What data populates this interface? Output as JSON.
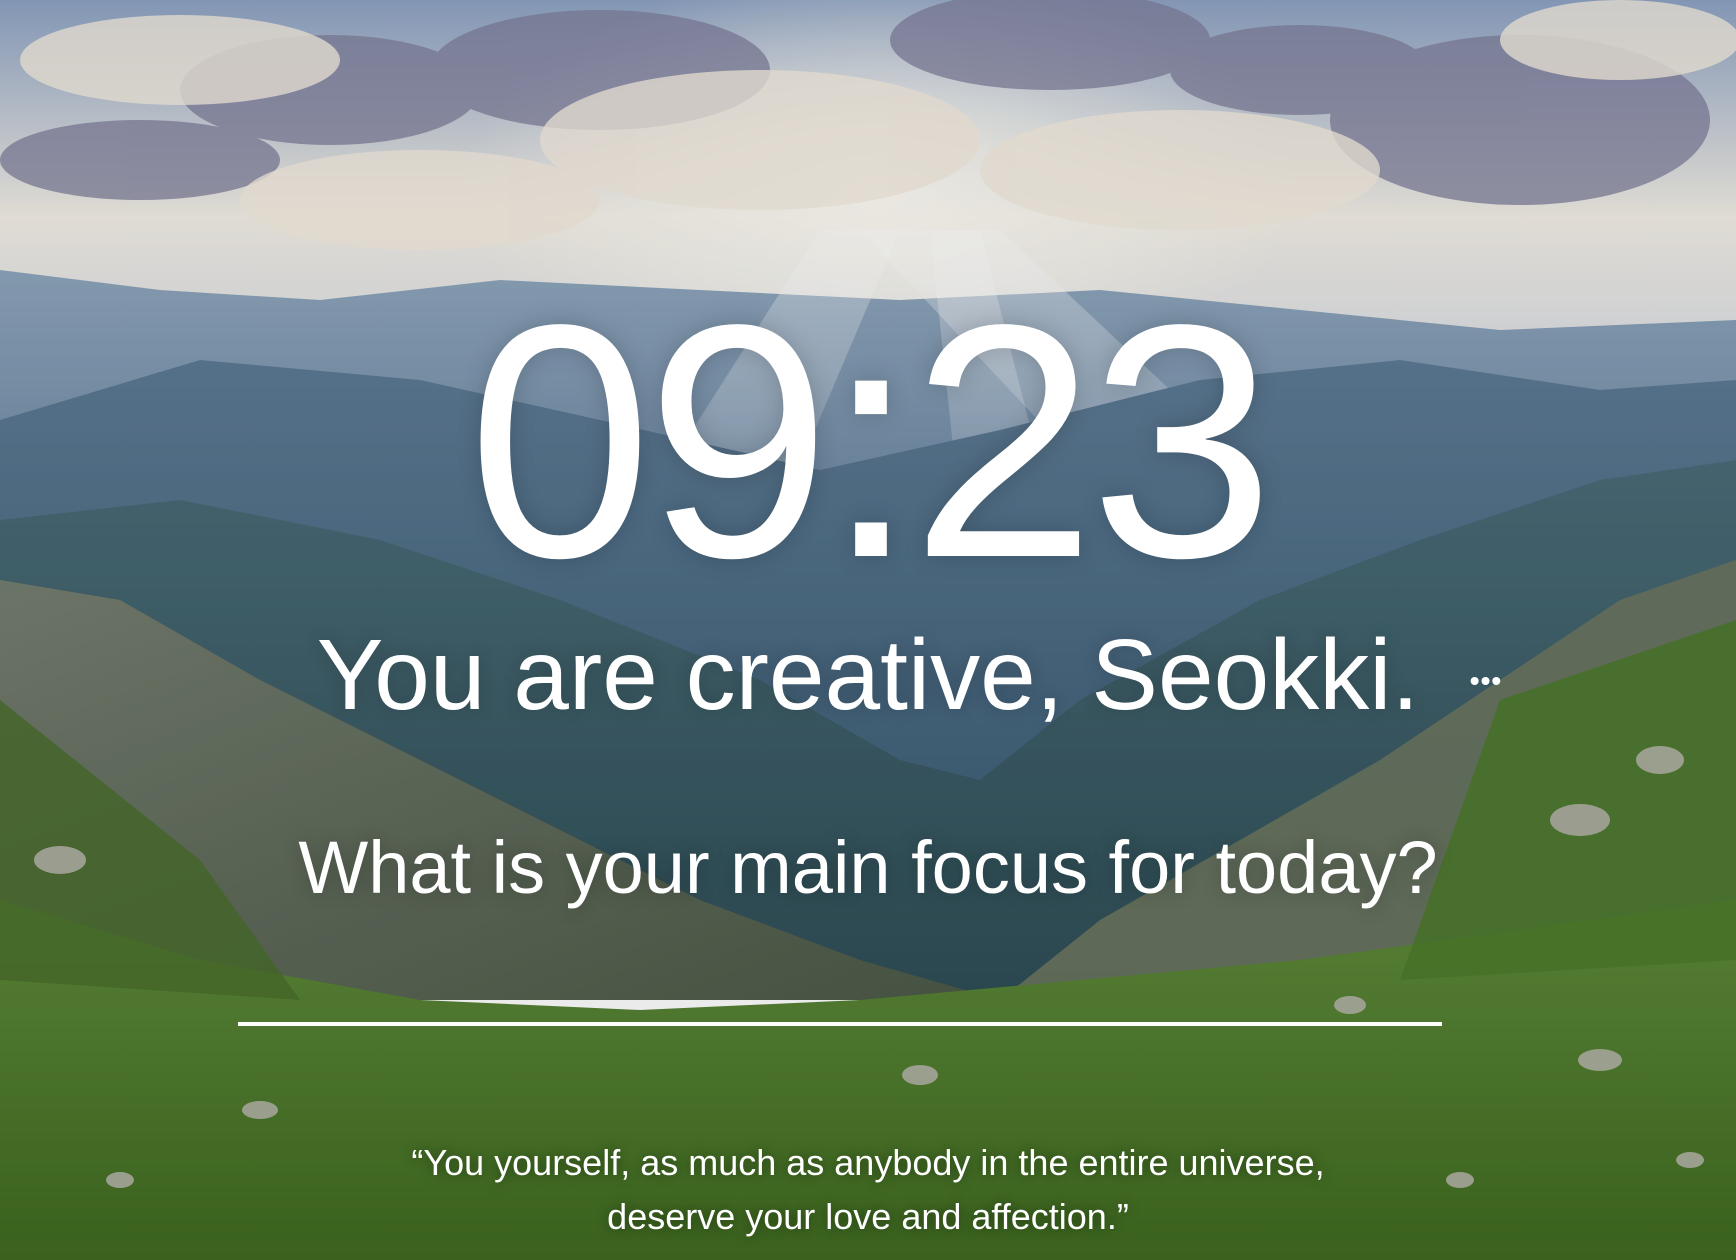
{
  "background": {
    "scene": "mountain-valley-sunrise-photo",
    "sky_color": "#cfd7e3",
    "mountain_color": "#3f5f78",
    "grass_color": "#4f7a2c"
  },
  "clock": {
    "time": "09:23"
  },
  "greeting": {
    "text": "You are creative, Seokki.",
    "more_icon": "ellipsis-icon",
    "more_label": "•••"
  },
  "focus": {
    "prompt": "What is your main focus for today?",
    "value": "",
    "placeholder": ""
  },
  "quote": {
    "line1": "“You yourself, as much as anybody in the entire universe,",
    "line2": "deserve your love and affection.”"
  }
}
